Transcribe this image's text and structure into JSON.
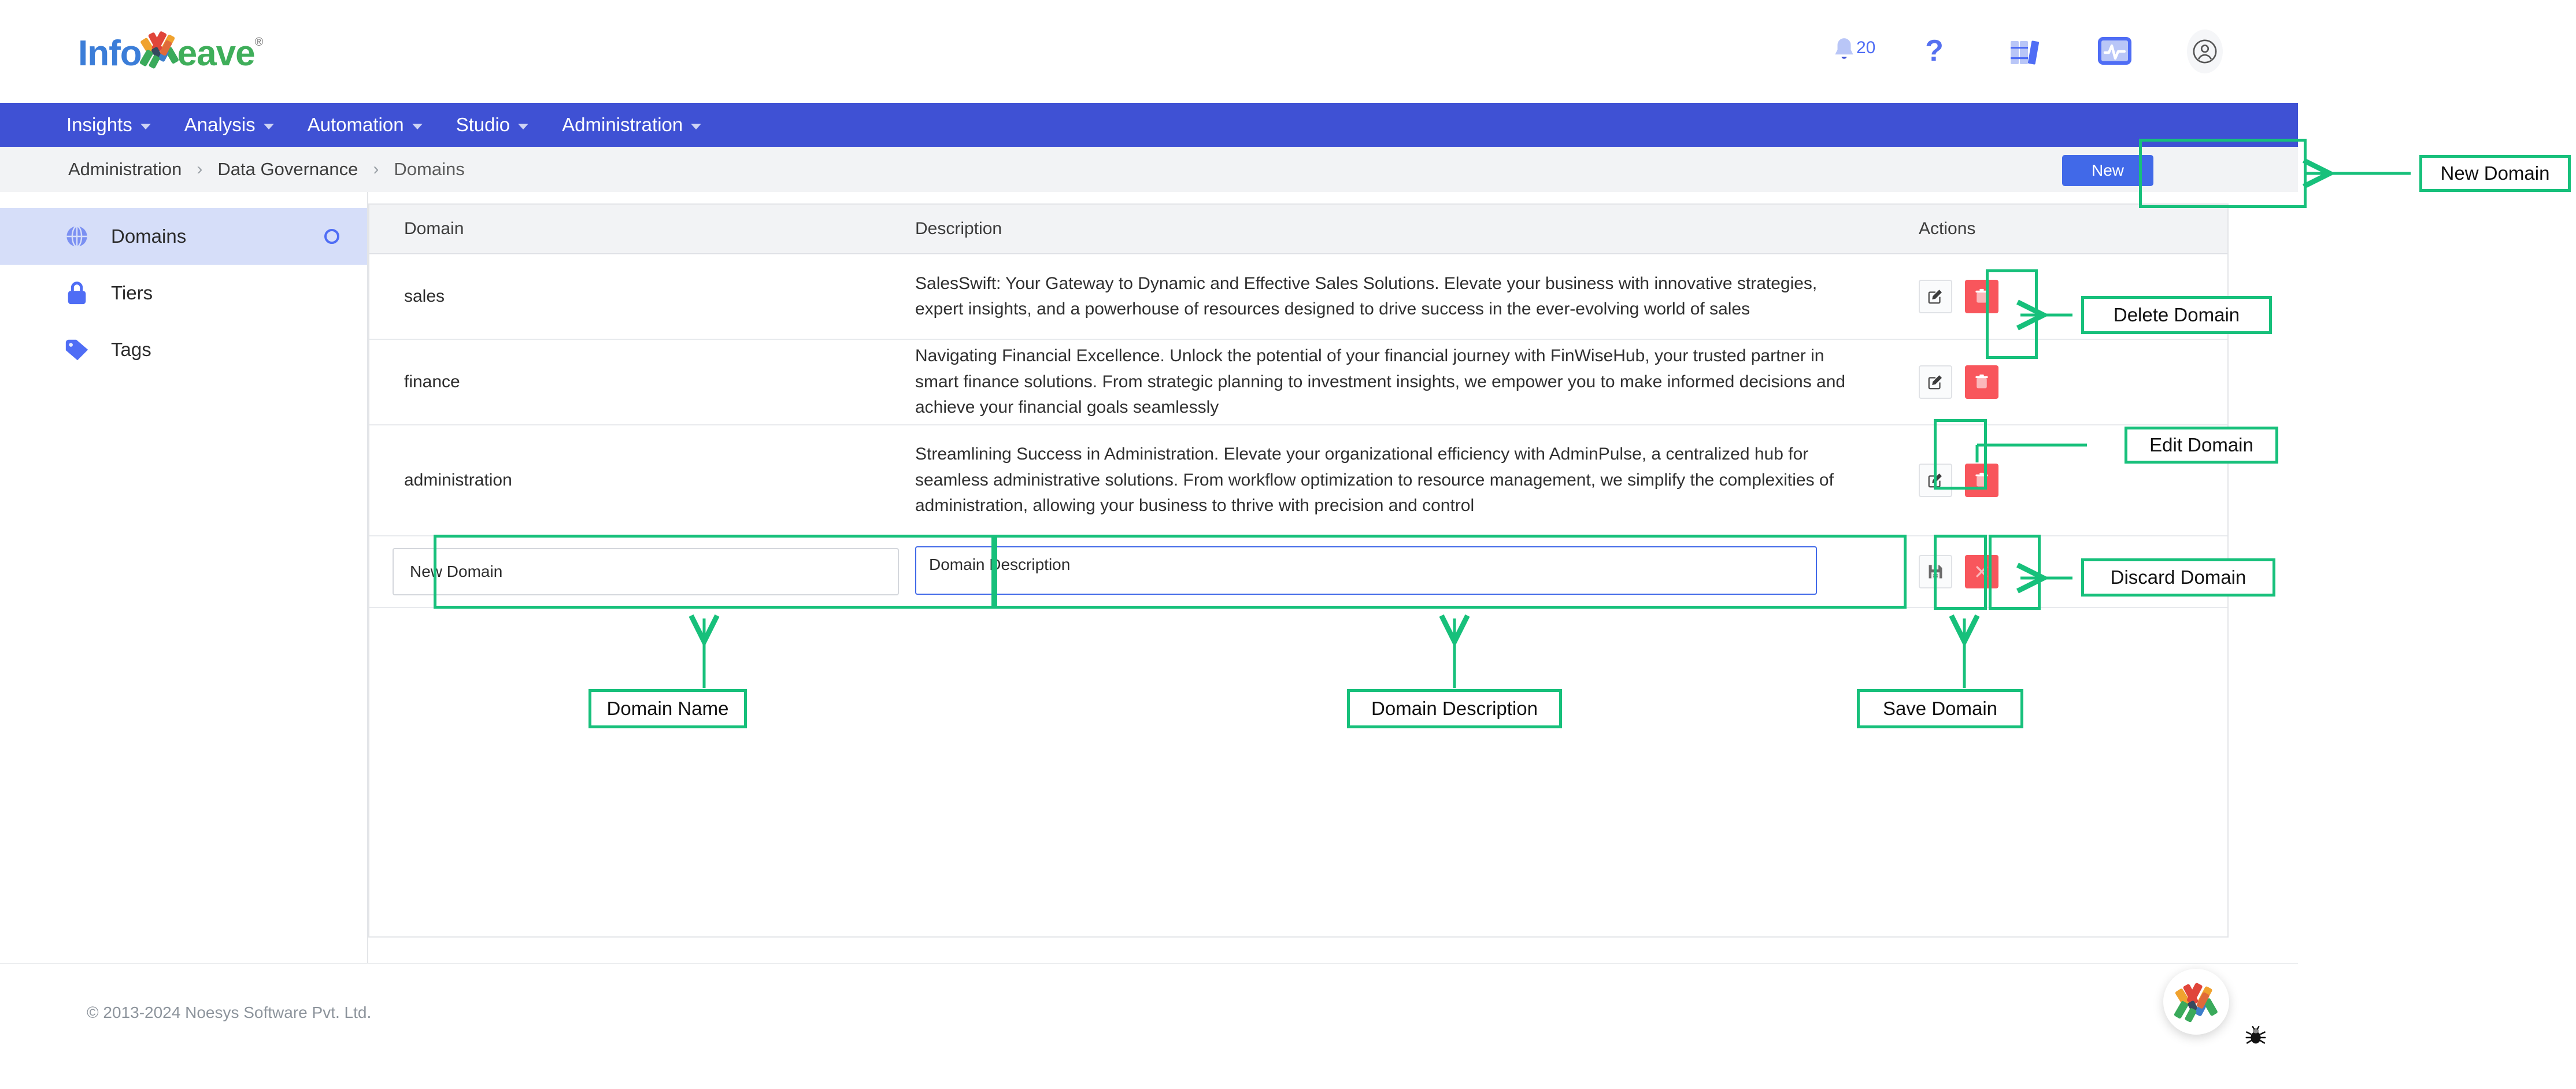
{
  "brand": {
    "name_part1": "Info",
    "name_part2": "eave",
    "registered": "®",
    "logo_icon": "infoweave-woven-logo"
  },
  "header": {
    "icons": [
      {
        "name": "notification-bell-icon",
        "glyph": "bell",
        "badge": "20"
      },
      {
        "name": "help-question-icon",
        "glyph": "question"
      },
      {
        "name": "library-books-icon",
        "glyph": "books"
      },
      {
        "name": "monitor-activity-icon",
        "glyph": "monitor"
      },
      {
        "name": "user-account-icon",
        "glyph": "avatar"
      }
    ]
  },
  "nav": {
    "items": [
      {
        "label": "Insights",
        "has_caret": true
      },
      {
        "label": "Analysis",
        "has_caret": true
      },
      {
        "label": "Automation",
        "has_caret": true
      },
      {
        "label": "Studio",
        "has_caret": true
      },
      {
        "label": "Administration",
        "has_caret": true
      }
    ]
  },
  "breadcrumb": {
    "separator": "›",
    "items": [
      "Administration",
      "Data Governance",
      "Domains"
    ]
  },
  "sidebar": {
    "items": [
      {
        "label": "Domains",
        "icon": "globe-icon",
        "active": true,
        "indicator": true
      },
      {
        "label": "Tiers",
        "icon": "lock-icon",
        "active": false,
        "indicator": false
      },
      {
        "label": "Tags",
        "icon": "tag-icon",
        "active": false,
        "indicator": false
      }
    ]
  },
  "toolbar": {
    "new_label": "New"
  },
  "table": {
    "columns": [
      "Domain",
      "Description",
      "Actions"
    ],
    "rows": [
      {
        "domain": "sales",
        "description": "SalesSwift: Your Gateway to Dynamic and Effective Sales Solutions. Elevate your business with innovative strategies, expert insights, and a powerhouse of resources designed to drive success in the ever-evolving world of sales",
        "actions": [
          "edit",
          "delete"
        ]
      },
      {
        "domain": "finance",
        "description": "Navigating Financial Excellence. Unlock the potential of your financial journey with FinWiseHub, your trusted partner in smart finance solutions. From strategic planning to investment insights, we empower you to make informed decisions and achieve your financial goals seamlessly",
        "actions": [
          "edit",
          "delete"
        ]
      },
      {
        "domain": "administration",
        "description": "Streamlining Success in Administration. Elevate your organizational efficiency with AdminPulse, a centralized hub for seamless administrative solutions. From workflow optimization to resource management, we simplify the complexities of administration, allowing your business to thrive with precision and control",
        "actions": [
          "edit",
          "delete"
        ]
      }
    ],
    "edit_row": {
      "domain_value": "New Domain",
      "domain_placeholder": "New Domain",
      "description_value": "Domain Description",
      "description_placeholder": "Domain Description",
      "actions": [
        "save",
        "discard"
      ]
    }
  },
  "annotations": [
    {
      "label": "New Domain"
    },
    {
      "label": "Delete Domain"
    },
    {
      "label": "Edit Domain"
    },
    {
      "label": "Discard Domain"
    },
    {
      "label": "Domain Name"
    },
    {
      "label": "Domain Description"
    },
    {
      "label": "Save Domain"
    }
  ],
  "footer": {
    "copyright": "© 2013-2024 Noesys Software Pvt. Ltd."
  },
  "floating": {
    "chat_icon": "infoweave-logo-icon",
    "bug_icon": "bug-icon"
  },
  "colors": {
    "nav_blue": "#3f51d4",
    "accent_blue": "#4169e8",
    "danger_red": "#f8565c",
    "annotation_green": "#17c07b",
    "sidebar_active": "#d6def9"
  }
}
